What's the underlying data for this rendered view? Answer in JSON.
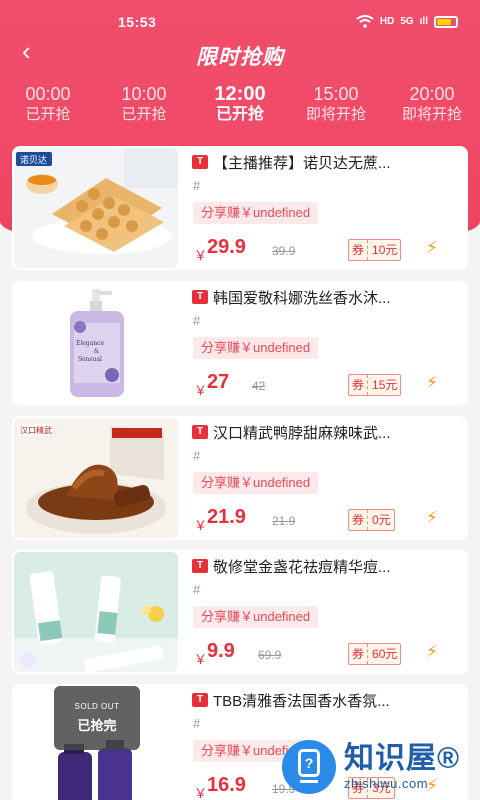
{
  "status": {
    "time": "15:53",
    "hd": "HD",
    "network": "5G",
    "signal": "ıll"
  },
  "header": {
    "back": "‹",
    "title": "限时抢购"
  },
  "time_tabs": [
    {
      "time": "00:00",
      "status": "已开抢"
    },
    {
      "time": "10:00",
      "status": "已开抢"
    },
    {
      "time": "12:00",
      "status": "已开抢",
      "active": true
    },
    {
      "time": "15:00",
      "status": "即将开抢"
    },
    {
      "time": "20:00",
      "status": "即将开抢"
    }
  ],
  "products": [
    {
      "title": "【主播推荐】诺贝达无蔗...",
      "hash": "#",
      "share": "分享赚￥undefined",
      "price": "29.9",
      "original": "39.9",
      "coupon_label": "券",
      "coupon_value": "10元"
    },
    {
      "title": "韩国爱敬科娜洗丝香水沐...",
      "hash": "#",
      "share": "分享赚￥undefined",
      "price": "27",
      "original": "42",
      "coupon_label": "券",
      "coupon_value": "15元"
    },
    {
      "title": "汉口精武鸭脖甜麻辣味武...",
      "hash": "#",
      "share": "分享赚￥undefined",
      "price": "21.9",
      "original": "21.9",
      "coupon_label": "券",
      "coupon_value": "0元"
    },
    {
      "title": "敬修堂金盏花祛痘精华痘...",
      "hash": "#",
      "share": "分享赚￥undefined",
      "price": "9.9",
      "original": "69.9",
      "coupon_label": "券",
      "coupon_value": "60元"
    },
    {
      "title": "TBB清雅香法国香水香氛...",
      "hash": "#",
      "share": "分享赚￥undefined",
      "price": "16.9",
      "original": "19.9",
      "coupon_label": "券",
      "coupon_value": "3元",
      "soldout_en": "SOLD OUT",
      "soldout_zh": "已抢完"
    }
  ],
  "labels": {
    "currency": "￥",
    "tag": "T"
  },
  "watermark": {
    "zh": "知识屋®",
    "en": "zhishiwu.com",
    "icon": "?"
  },
  "colors": {
    "accent": "#e8303d",
    "header": "#f04e6c"
  }
}
